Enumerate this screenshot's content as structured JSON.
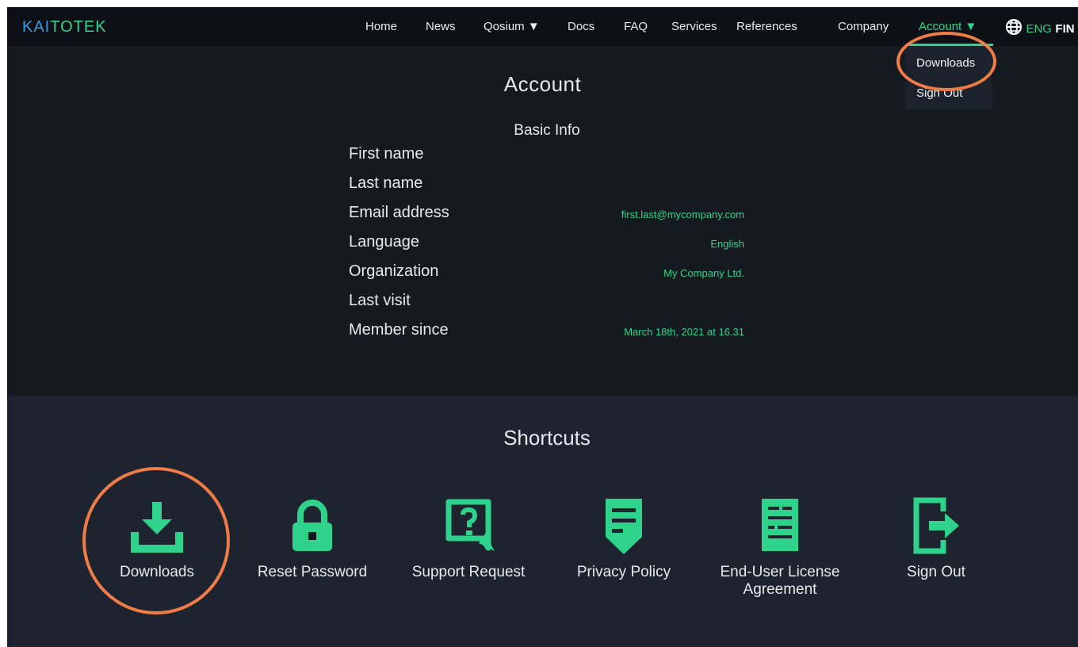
{
  "brand": {
    "logo_text_a": "KAI",
    "logo_text_b": "TOTEK"
  },
  "nav": {
    "items": [
      {
        "label": "Home"
      },
      {
        "label": "News"
      },
      {
        "label": "Qosium ▼"
      },
      {
        "label": "Docs"
      },
      {
        "label": "FAQ"
      },
      {
        "label": "Services"
      },
      {
        "label": "References"
      },
      {
        "label": "Company"
      },
      {
        "label": "Account ▼"
      }
    ],
    "lang_active": "ENG",
    "lang_other": "FIN"
  },
  "dropdown": {
    "items": [
      {
        "label": "Downloads"
      },
      {
        "label": "Sign Out"
      }
    ]
  },
  "account": {
    "title": "Account",
    "section_title": "Basic Info",
    "fields": [
      {
        "label": "First name",
        "value": ""
      },
      {
        "label": "Last name",
        "value": ""
      },
      {
        "label": "Email address",
        "value": "first.last@mycompany.com"
      },
      {
        "label": "Language",
        "value": "English"
      },
      {
        "label": "Organization",
        "value": "My Company Ltd."
      },
      {
        "label": "Last visit",
        "value": ""
      },
      {
        "label": "Member since",
        "value": "March 18th, 2021 at 16.31"
      }
    ]
  },
  "shortcuts": {
    "title": "Shortcuts",
    "items": [
      {
        "label": "Downloads",
        "icon": "download-icon"
      },
      {
        "label": "Reset Password",
        "icon": "lock-icon"
      },
      {
        "label": "Support Request",
        "icon": "support-request-icon"
      },
      {
        "label": "Privacy Policy",
        "icon": "privacy-policy-icon"
      },
      {
        "label": "End-User License Agreement",
        "icon": "license-document-icon"
      },
      {
        "label": "Sign Out",
        "icon": "sign-out-icon"
      }
    ]
  },
  "colors": {
    "accent": "#2fd28b",
    "highlight": "#f07c45",
    "header_bg": "#0d1117",
    "page_bg": "#151a21",
    "shortcuts_bg": "#1d2430"
  }
}
